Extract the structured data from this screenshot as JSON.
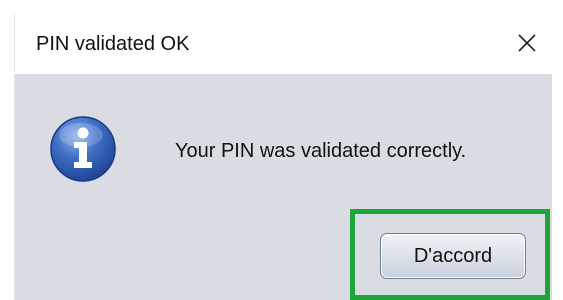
{
  "window": {
    "title": "PIN validated OK"
  },
  "dialog": {
    "icon": "info-icon",
    "message": "Your PIN was validated correctly.",
    "ok_label": "D'accord"
  },
  "colors": {
    "highlight": "#1fa63a",
    "dialog_background": "#d9dce3",
    "icon_blue": "#2f5fb4"
  }
}
